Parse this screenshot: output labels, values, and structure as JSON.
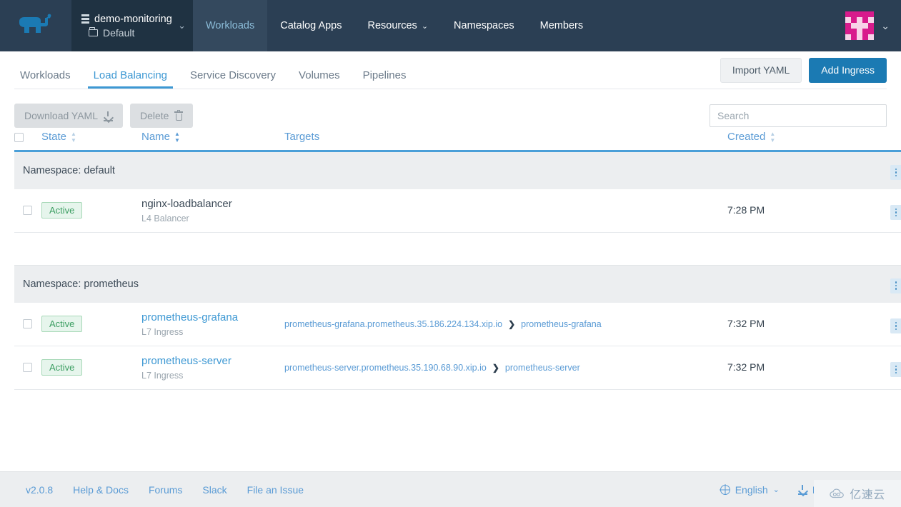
{
  "header": {
    "logo_name": "rancher-logo",
    "cluster": {
      "name": "demo-monitoring",
      "project": "Default",
      "caret": "⌄"
    },
    "nav": [
      {
        "label": "Workloads",
        "active": true,
        "caret": ""
      },
      {
        "label": "Catalog Apps",
        "active": false,
        "caret": ""
      },
      {
        "label": "Resources",
        "active": false,
        "caret": "⌄"
      },
      {
        "label": "Namespaces",
        "active": false,
        "caret": ""
      },
      {
        "label": "Members",
        "active": false,
        "caret": ""
      }
    ],
    "avatar_caret": "⌄",
    "avatar_color": "#d81b8c"
  },
  "subbar": {
    "tabs": [
      {
        "label": "Workloads",
        "active": false
      },
      {
        "label": "Load Balancing",
        "active": true
      },
      {
        "label": "Service Discovery",
        "active": false
      },
      {
        "label": "Volumes",
        "active": false
      },
      {
        "label": "Pipelines",
        "active": false
      }
    ],
    "import_yaml_label": "Import YAML",
    "add_ingress_label": "Add Ingress"
  },
  "toolbar": {
    "download_yaml_label": "Download YAML",
    "delete_label": "Delete",
    "search_placeholder": "Search",
    "search_value": ""
  },
  "table": {
    "columns": {
      "state": "State",
      "name": "Name",
      "targets": "Targets",
      "created": "Created"
    },
    "groups": [
      {
        "label": "Namespace: default",
        "rows": [
          {
            "state": "Active",
            "name": "nginx-loadbalancer",
            "name_is_link": false,
            "type": "L4 Balancer",
            "target_host": "",
            "target_sep": "",
            "target_service": "",
            "created": "7:28 PM"
          }
        ]
      },
      {
        "label": "Namespace: prometheus",
        "rows": [
          {
            "state": "Active",
            "name": "prometheus-grafana",
            "name_is_link": true,
            "type": "L7 Ingress",
            "target_host": "prometheus-grafana.prometheus.35.186.224.134.xip.io",
            "target_sep": "❯",
            "target_service": "prometheus-grafana",
            "created": "7:32 PM"
          },
          {
            "state": "Active",
            "name": "prometheus-server",
            "name_is_link": true,
            "type": "L7 Ingress",
            "target_host": "prometheus-server.prometheus.35.190.68.90.xip.io",
            "target_sep": "❯",
            "target_service": "prometheus-server",
            "created": "7:32 PM"
          }
        ]
      }
    ]
  },
  "footer": {
    "links": [
      "v2.0.8",
      "Help & Docs",
      "Forums",
      "Slack",
      "File an Issue"
    ],
    "language_label": "English",
    "download_cli_label": "Download CLI",
    "caret": "⌄"
  },
  "watermark": {
    "text": "亿速云"
  },
  "colors": {
    "header_bg": "#2b3f54",
    "cluster_bg": "#1f3242",
    "accent_blue": "#3d98d3",
    "primary_btn": "#1b7ab3",
    "link_blue": "#5a9bd5",
    "active_green": "#3c9e62",
    "active_green_bg": "#e6f5ec",
    "group_bg": "#eceef0"
  }
}
